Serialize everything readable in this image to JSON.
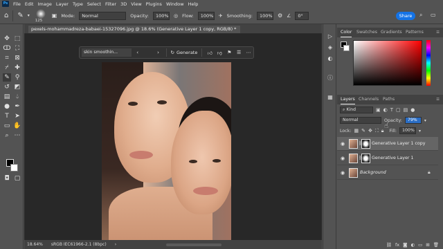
{
  "menubar": {
    "logo": "Ps",
    "items": [
      "File",
      "Edit",
      "Image",
      "Layer",
      "Type",
      "Select",
      "Filter",
      "3D",
      "View",
      "Plugins",
      "Window",
      "Help"
    ]
  },
  "options_bar": {
    "brush_size": "125",
    "mode_label": "Mode:",
    "mode_value": "Normal",
    "opacity_label": "Opacity:",
    "opacity_value": "100%",
    "flow_label": "Flow:",
    "flow_value": "100%",
    "smoothing_label": "Smoothing:",
    "smoothing_value": "100%",
    "angle_value": "0°",
    "share_label": "Share"
  },
  "document": {
    "tab_title": "pexels-mohammadreza-babaei-15327096.jpg @ 18.6% (Generative Layer 1 copy, RGB/8) *"
  },
  "taskbar": {
    "prompt_value": "skin smoothin...",
    "prev_icon": "chevron-left-icon",
    "next_icon": "chevron-right-icon",
    "generate_label": "Generate"
  },
  "status_bar": {
    "zoom": "18.64%",
    "profile": "sRGB IEC61966-2.1 (8bpc)"
  },
  "color_panel": {
    "tabs": [
      "Color",
      "Swatches",
      "Gradients",
      "Patterns"
    ],
    "active_tab": "Color"
  },
  "layers_panel": {
    "tabs": [
      "Layers",
      "Channels",
      "Paths"
    ],
    "active_tab": "Layers",
    "kind_label": "Kind",
    "blend_mode": "Normal",
    "opacity_label": "Opacity:",
    "opacity_value": "79%",
    "lock_label": "Lock:",
    "fill_label": "Fill:",
    "fill_value": "100%",
    "layers": [
      {
        "name": "Generative Layer 1 copy",
        "selected": true
      },
      {
        "name": "Generative Layer 1",
        "selected": false
      },
      {
        "name": "Background",
        "selected": false
      }
    ],
    "footer_fx": "fx"
  }
}
